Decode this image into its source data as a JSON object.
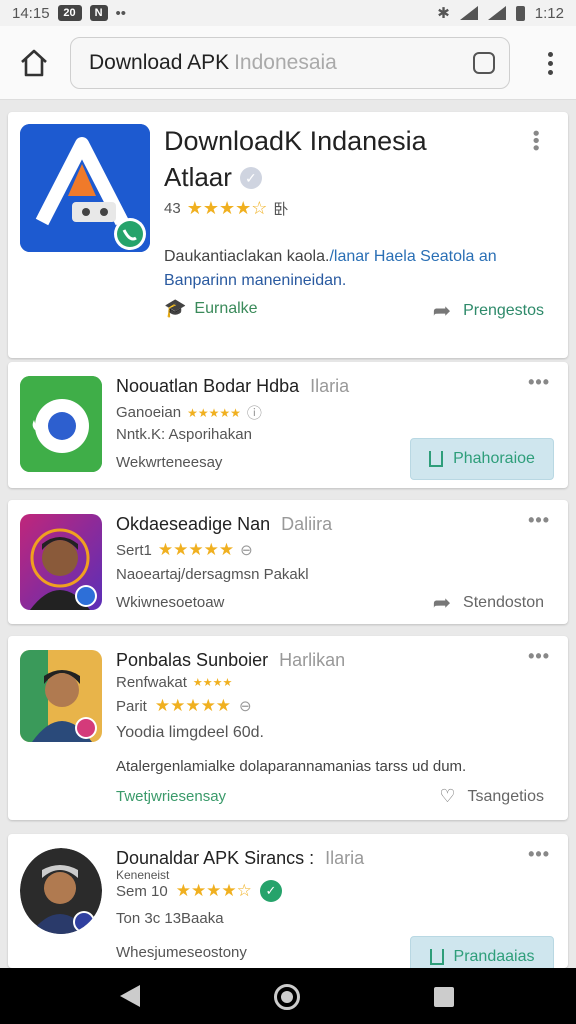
{
  "status_bar": {
    "time_left": "14:15",
    "box1": "20",
    "box2": "N",
    "dots": "••",
    "time_right": "1:12"
  },
  "browser": {
    "url_main": "Download APK",
    "url_faint": "Indonesaia"
  },
  "featured": {
    "title": "DownloadK Indanesia",
    "subtitle": "Atlaar",
    "rating_num": "43",
    "stars": "★★★★☆",
    "rating_extra": "卧",
    "description_1": "Daukantiaclakan kaola.",
    "description_1_blue": "/lanar Haela Seatola an",
    "description_2": "Banparinn manenineidan.",
    "tag": "Eurnalke",
    "share_label": "Prengestos",
    "colors": {
      "icon_bg": "#1f56c8",
      "accent_green": "#2e9e6a"
    }
  },
  "apps": [
    {
      "title": "Noouatlan Bodar Hdba",
      "title_faint": "Ilaria",
      "line1": "Ganoeian",
      "stars": "★★★★★",
      "line2": "Nntk.K: Asporihakan",
      "line3": "Wekwrteneesay",
      "action": "Phahoraioe"
    },
    {
      "title": "Okdaeseadige Nan",
      "title_faint": "Daliira",
      "line1": "Sert1",
      "stars": "★★★★★",
      "line2": "Naoeartaj/dersagmsn Pakakl",
      "line3": "Wkiwnesoetoaw",
      "action": "Stendoston"
    },
    {
      "title": "Ponbalas Sunboier",
      "title_faint": "Harlikan",
      "line1": "Renfwakat",
      "small_stars": "★★★★",
      "line_rating": "Parit",
      "stars": "★★★★★",
      "line2": "Yoodia limgdeel 60d.",
      "line3": "Atalergenlamialke dolaparannamanias tarss ud dum.",
      "line4": "Twetjwriesensay",
      "action": "Tsangetios"
    },
    {
      "title": "Dounaldar APK Sirancs :",
      "title_faint": "Ilaria",
      "line1": "Keneneist",
      "line_rating": "Sem 10",
      "stars": "★★★★☆",
      "line2": "Ton 3c 13Baaka",
      "line3": "Whesjumeseostony",
      "action": "Prandaaias"
    }
  ],
  "more_icon": "•••"
}
